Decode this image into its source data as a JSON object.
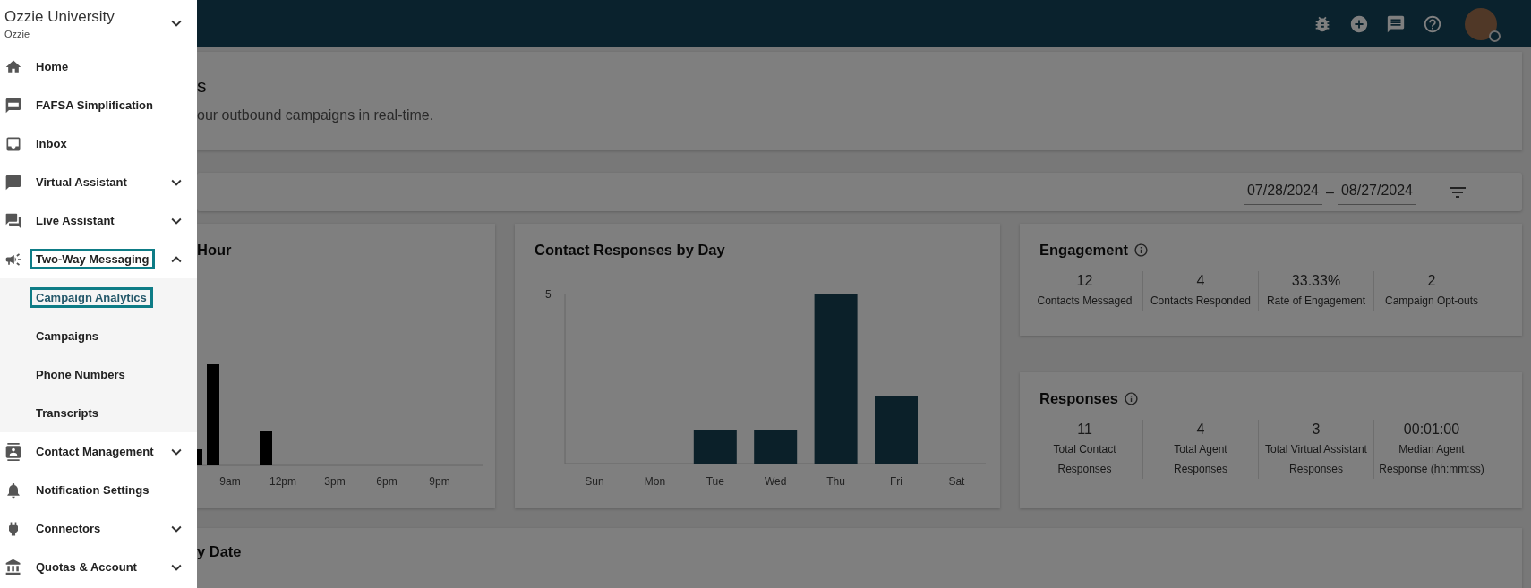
{
  "sidebar": {
    "org_name": "Ozzie University",
    "org_short": "Ozzie",
    "items": [
      {
        "label": "Home",
        "kind": "link",
        "selected": false,
        "outlined": false
      },
      {
        "label": "FAFSA Simplification",
        "kind": "link",
        "selected": false,
        "outlined": false
      },
      {
        "label": "Inbox",
        "kind": "link",
        "selected": false,
        "outlined": false
      },
      {
        "label": "Virtual Assistant",
        "kind": "group",
        "expanded": false,
        "selected": false,
        "outlined": false
      },
      {
        "label": "Live Assistant",
        "kind": "group",
        "expanded": false,
        "selected": false,
        "outlined": false
      },
      {
        "label": "Two-Way Messaging",
        "kind": "group",
        "expanded": true,
        "selected": false,
        "outlined": true,
        "children": [
          {
            "label": "Campaign Analytics",
            "selected": true,
            "outlined": true
          },
          {
            "label": "Campaigns",
            "selected": false,
            "outlined": false
          },
          {
            "label": "Phone Numbers",
            "selected": false,
            "outlined": false
          },
          {
            "label": "Transcripts",
            "selected": false,
            "outlined": false
          }
        ]
      },
      {
        "label": "Contact Management",
        "kind": "group",
        "expanded": false,
        "selected": false,
        "outlined": false
      },
      {
        "label": "Notification Settings",
        "kind": "link",
        "selected": false,
        "outlined": false
      },
      {
        "label": "Connectors",
        "kind": "group",
        "expanded": false,
        "selected": false,
        "outlined": false
      },
      {
        "label": "Quotas & Account",
        "kind": "group",
        "expanded": false,
        "selected": false,
        "outlined": false
      }
    ]
  },
  "page_header": {
    "title": "s",
    "subtitle": "our outbound campaigns in real-time."
  },
  "filter_bar": {
    "start_date": "07/28/2024",
    "separator": "–",
    "end_date": "08/27/2024"
  },
  "hour_chart": {
    "title": "Hour",
    "x_labels": [
      "9am",
      "12pm",
      "3pm",
      "6pm",
      "9pm"
    ]
  },
  "day_chart": {
    "title": "Contact Responses by Day",
    "y_label": "5",
    "x_labels": [
      "Sun",
      "Mon",
      "Tue",
      "Wed",
      "Thu",
      "Fri",
      "Sat"
    ]
  },
  "engagement": {
    "title": "Engagement",
    "stats": [
      {
        "value": "12",
        "label": "Contacts Messaged"
      },
      {
        "value": "4",
        "label": "Contacts Responded"
      },
      {
        "value": "33.33%",
        "label": "Rate of Engagement"
      },
      {
        "value": "2",
        "label": "Campaign Opt-outs"
      }
    ]
  },
  "responses": {
    "title": "Responses",
    "stats": [
      {
        "value": "11",
        "label": "Total Contact Responses"
      },
      {
        "value": "4",
        "label": "Total Agent Responses"
      },
      {
        "value": "3",
        "label": "Total Virtual Assistant Responses"
      },
      {
        "value": "00:01:00",
        "label": "Median Agent Response (hh:mm:ss)"
      }
    ]
  },
  "date_card": {
    "title": "y Date"
  }
}
